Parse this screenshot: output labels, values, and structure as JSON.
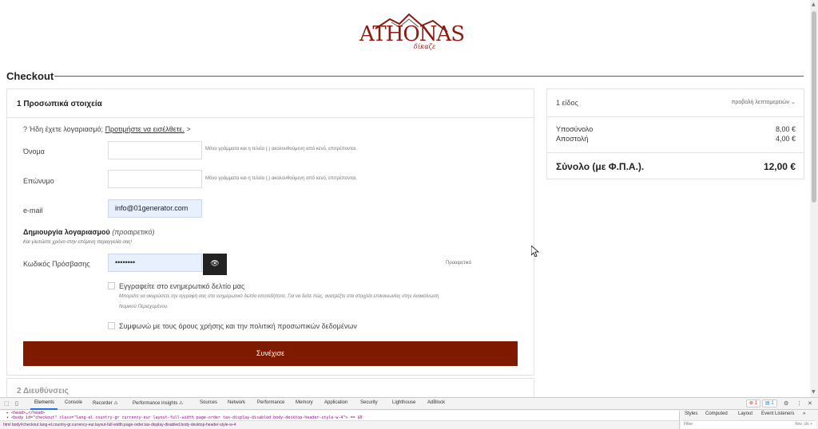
{
  "logo": {
    "text": "ATHONAS",
    "sub": "δίκαζε"
  },
  "page_title": "Checkout",
  "step1": {
    "title": "1 Προσωπικά στοιχεία",
    "login_prompt": "Ήδη έχετε λογαριασμό;",
    "login_link": "Προτιμήστε να εισέλθετε.",
    "login_arrow": ">",
    "first_name": {
      "label": "Όνομα",
      "value": "",
      "hint": "Μόνο γράμματα και η τελεία (.) ακολουθούμενη από κενό, επιτρέπονται."
    },
    "last_name": {
      "label": "Επώνυμο",
      "value": "",
      "hint": "Μόνο γράμματα και η τελεία (.) ακολουθούμενη από κενό, επιτρέπονται."
    },
    "email": {
      "label": "e-mail",
      "value": "info@01generator.com"
    },
    "account_title": "Δημιουργία λογαριασμού",
    "account_optional": "(προαιρετικό)",
    "account_sub": "Και γλυτώστε χρόνο στην επόμενη παραγγελία σας!",
    "password": {
      "label": "Κωδικός Πρόσβασης",
      "value": "••••••••",
      "optional": "Προαιρετικό"
    },
    "newsletter_label": "Εγγραφείτε στο ενημερωτικό δελτίο μας",
    "newsletter_sub": "Μπορείτε να ακυρώσετε την εγγραφή σας στο ενημερωτικό δελτίο οποτεδήποτε. Για να δείτε πώς, ανατρέξτε στα στοιχεία επικοινωνίας στην Ανακοίνωση Νομικού Περιεχομένου.",
    "terms_label": "Συμφωνώ με τους όρους χρήσης και την πολιτική προσωπικών δεδομένων",
    "continue_label": "Συνέχισε"
  },
  "step2": {
    "title": "2 Διευθύνσεις"
  },
  "summary": {
    "item_count": "1 είδος",
    "details_link": "προβολή λεπτομερειών ⌄",
    "subtotal_label": "Υποσύνολο",
    "subtotal_value": "8,00 €",
    "shipping_label": "Αποστολή",
    "shipping_value": "4,00 €",
    "total_label": "Σύνολο (με Φ.Π.Α.).",
    "total_value": "12,00 €"
  },
  "devtools": {
    "tabs": [
      "Elements",
      "Console",
      "Recorder ⚠",
      "Performance insights ⚠",
      "Sources",
      "Network",
      "Performance",
      "Memory",
      "Application",
      "Security",
      "Lighthouse",
      "AdBlock"
    ],
    "error_count": "1",
    "message_count": "1",
    "code_line1": "▸ <head>…</head>",
    "code_line2": "▾ <body id=\"checkout\" class=\"lang-el country-gr currency-eur layout-full-width page-order tax-display-disabled body-desktop-header-style-w-4\"> == $0",
    "breadcrumb": "html   body#checkout.lang-el.country-gr.currency-eur.layout-full-width.page-order.tax-display-disabled.body-desktop-header-style-w-4",
    "side_tabs": [
      "Styles",
      "Computed",
      "Layout",
      "Event Listeners",
      "»"
    ],
    "filter_placeholder": "Filter",
    "filter_tools": ":hov  .cls  +"
  }
}
